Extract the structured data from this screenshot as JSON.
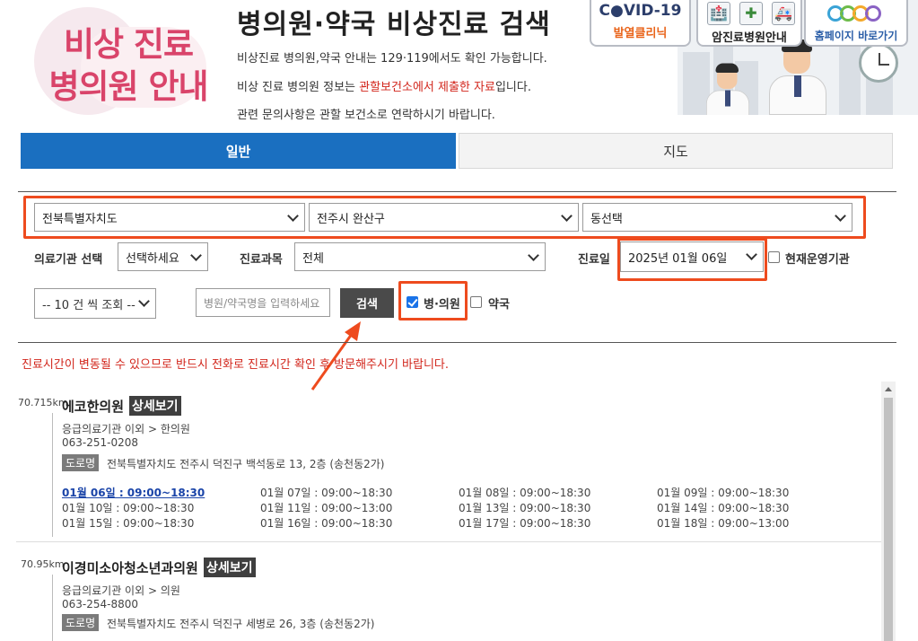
{
  "header": {
    "logo_line1": "비상 진료",
    "logo_line2": "병의원 안내",
    "title": "병의원·약국 비상진료 검색",
    "desc1": "비상진료 병의원,약국 안내는 129·119에서도 확인 가능합니다.",
    "desc2_pre": "비상 진료 병의원 정보는 ",
    "desc2_red": "관할보건소에서 제출한 자료",
    "desc2_post": "입니다.",
    "desc3": "관련 문의사항은 관할 보건소로 연락하시기 바랍니다."
  },
  "quick_links": {
    "covid_title": "C●VID-19",
    "covid_sub": "발열클리닉",
    "cancer_label": "암진료병원안내",
    "home_label": "홈페이지 바로가기"
  },
  "tabs": {
    "general": "일반",
    "map": "지도"
  },
  "filters": {
    "sido": "전북특별자치도",
    "gugun": "전주시 완산구",
    "dong": "동선택",
    "inst_label": "의료기관 선택",
    "inst_value": "선택하세요",
    "dept_label": "진료과목",
    "dept_value": "전체",
    "date_label": "진료일",
    "date_value": "2025년 01월 06일",
    "open_now_label": "현재운영기관",
    "count_value": "-- 10 건 씩 조회 --",
    "search_placeholder": "병원/약국명을 입력하세요",
    "search_button": "검색",
    "hospital_label": "병·의원",
    "pharmacy_label": "약국"
  },
  "notice": "진료시간이 변동될 수 있으므로 반드시 전화로 진료시간 확인 후 방문해주시기 바랍니다.",
  "results": [
    {
      "distance": "70.715km",
      "name": "에코한의원",
      "detail_label": "상세보기",
      "category": "응급의료기관 이외 > 한의원",
      "phone": "063-251-0208",
      "road_tag": "도로명",
      "address": "전북특별자치도 전주시 덕진구 백석동로 13, 2층 (송천동2가)",
      "schedule": [
        [
          "01월 06일 : 09:00~18:30",
          "01월 07일 : 09:00~18:30",
          "01월 08일 : 09:00~18:30",
          "01월 09일 : 09:00~18:30"
        ],
        [
          "01월 10일 : 09:00~18:30",
          "01월 11일 : 09:00~13:00",
          "01월 13일 : 09:00~18:30",
          "01월 14일 : 09:00~18:30"
        ],
        [
          "01월 15일 : 09:00~18:30",
          "01월 16일 : 09:00~18:30",
          "01월 17일 : 09:00~18:30",
          "01월 18일 : 09:00~13:00"
        ]
      ]
    },
    {
      "distance": "70.95km",
      "name": "이경미소아청소년과의원",
      "detail_label": "상세보기",
      "category": "응급의료기관 이외 > 의원",
      "phone": "063-254-8800",
      "road_tag": "도로명",
      "address": "전북특별자치도 전주시 덕진구 세병로 26, 3층 (송천동2가)"
    }
  ],
  "colors": {
    "primary": "#1a6fc0",
    "highlight": "#ee4b1e",
    "notice": "#d2251b",
    "logo": "#d9446a"
  }
}
